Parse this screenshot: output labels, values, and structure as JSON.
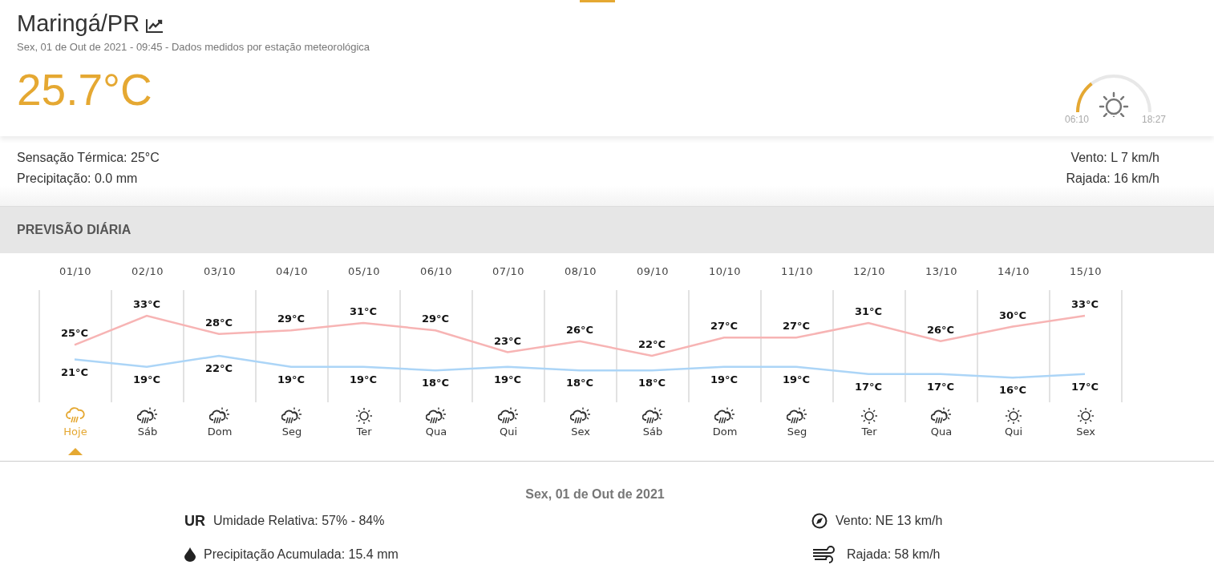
{
  "header": {
    "city": "Maringá/PR",
    "subtitle": "Sex, 01 de Out de 2021 - 09:45 - Dados medidos por estação meteorológica",
    "temperature": "25.7°C"
  },
  "sun": {
    "sunrise": "06:10",
    "sunset": "18:27"
  },
  "conditions": {
    "feels_like": "Sensação Térmica: 25°C",
    "precipitation": "Precipitação: 0.0 mm",
    "wind": "Vento: L 7 km/h",
    "gust": "Rajada: 16 km/h"
  },
  "forecast": {
    "title": "PREVISÃO DIÁRIA",
    "days": [
      {
        "date": "01/10",
        "max": "25°C",
        "min": "21°C",
        "kind": "rain",
        "day": "Hoje",
        "selected": true
      },
      {
        "date": "02/10",
        "max": "33°C",
        "min": "19°C",
        "kind": "sun-rain",
        "day": "Sáb",
        "selected": false
      },
      {
        "date": "03/10",
        "max": "28°C",
        "min": "22°C",
        "kind": "sun-rain",
        "day": "Dom",
        "selected": false
      },
      {
        "date": "04/10",
        "max": "29°C",
        "min": "19°C",
        "kind": "sun-rain",
        "day": "Seg",
        "selected": false
      },
      {
        "date": "05/10",
        "max": "31°C",
        "min": "19°C",
        "kind": "sun",
        "day": "Ter",
        "selected": false
      },
      {
        "date": "06/10",
        "max": "29°C",
        "min": "18°C",
        "kind": "sun-rain",
        "day": "Qua",
        "selected": false
      },
      {
        "date": "07/10",
        "max": "23°C",
        "min": "19°C",
        "kind": "sun-rain",
        "day": "Qui",
        "selected": false
      },
      {
        "date": "08/10",
        "max": "26°C",
        "min": "18°C",
        "kind": "sun-rain",
        "day": "Sex",
        "selected": false
      },
      {
        "date": "09/10",
        "max": "22°C",
        "min": "18°C",
        "kind": "sun-rain",
        "day": "Sáb",
        "selected": false
      },
      {
        "date": "10/10",
        "max": "27°C",
        "min": "19°C",
        "kind": "sun-rain",
        "day": "Dom",
        "selected": false
      },
      {
        "date": "11/10",
        "max": "27°C",
        "min": "19°C",
        "kind": "sun-rain",
        "day": "Seg",
        "selected": false
      },
      {
        "date": "12/10",
        "max": "31°C",
        "min": "17°C",
        "kind": "sun",
        "day": "Ter",
        "selected": false
      },
      {
        "date": "13/10",
        "max": "26°C",
        "min": "17°C",
        "kind": "sun-rain",
        "day": "Qua",
        "selected": false
      },
      {
        "date": "14/10",
        "max": "30°C",
        "min": "16°C",
        "kind": "sun",
        "day": "Qui",
        "selected": false
      },
      {
        "date": "15/10",
        "max": "33°C",
        "min": "17°C",
        "kind": "sun",
        "day": "Sex",
        "selected": false
      }
    ]
  },
  "detail": {
    "date": "Sex, 01 de Out de 2021",
    "humidity_badge": "UR",
    "humidity": "Umidade Relativa: 57% - 84%",
    "precipitation": "Precipitação Acumulada: 15.4 mm",
    "wind": "Vento: NE 13 km/h",
    "gust": "Rajada: 58 km/h"
  }
}
